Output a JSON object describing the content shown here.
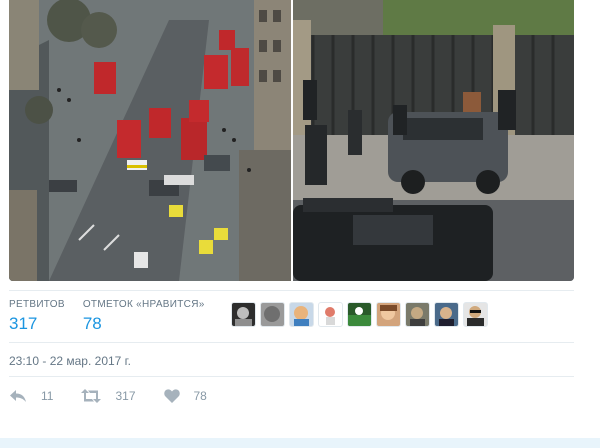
{
  "stats": {
    "retweets_label": "РЕТВИТОВ",
    "retweets_value": "317",
    "likes_label": "ОТМЕТОК «НРАВИТСЯ»",
    "likes_value": "78"
  },
  "timestamp": "23:10 - 22 мар. 2017 г.",
  "actions": {
    "reply_count": "11",
    "retweet_count": "317",
    "like_count": "78"
  },
  "colors": {
    "accent": "#1b95e0",
    "muted": "#657786",
    "icon": "#a6b2bc"
  },
  "icons": [
    "reply-icon",
    "retweet-icon",
    "heart-icon"
  ]
}
